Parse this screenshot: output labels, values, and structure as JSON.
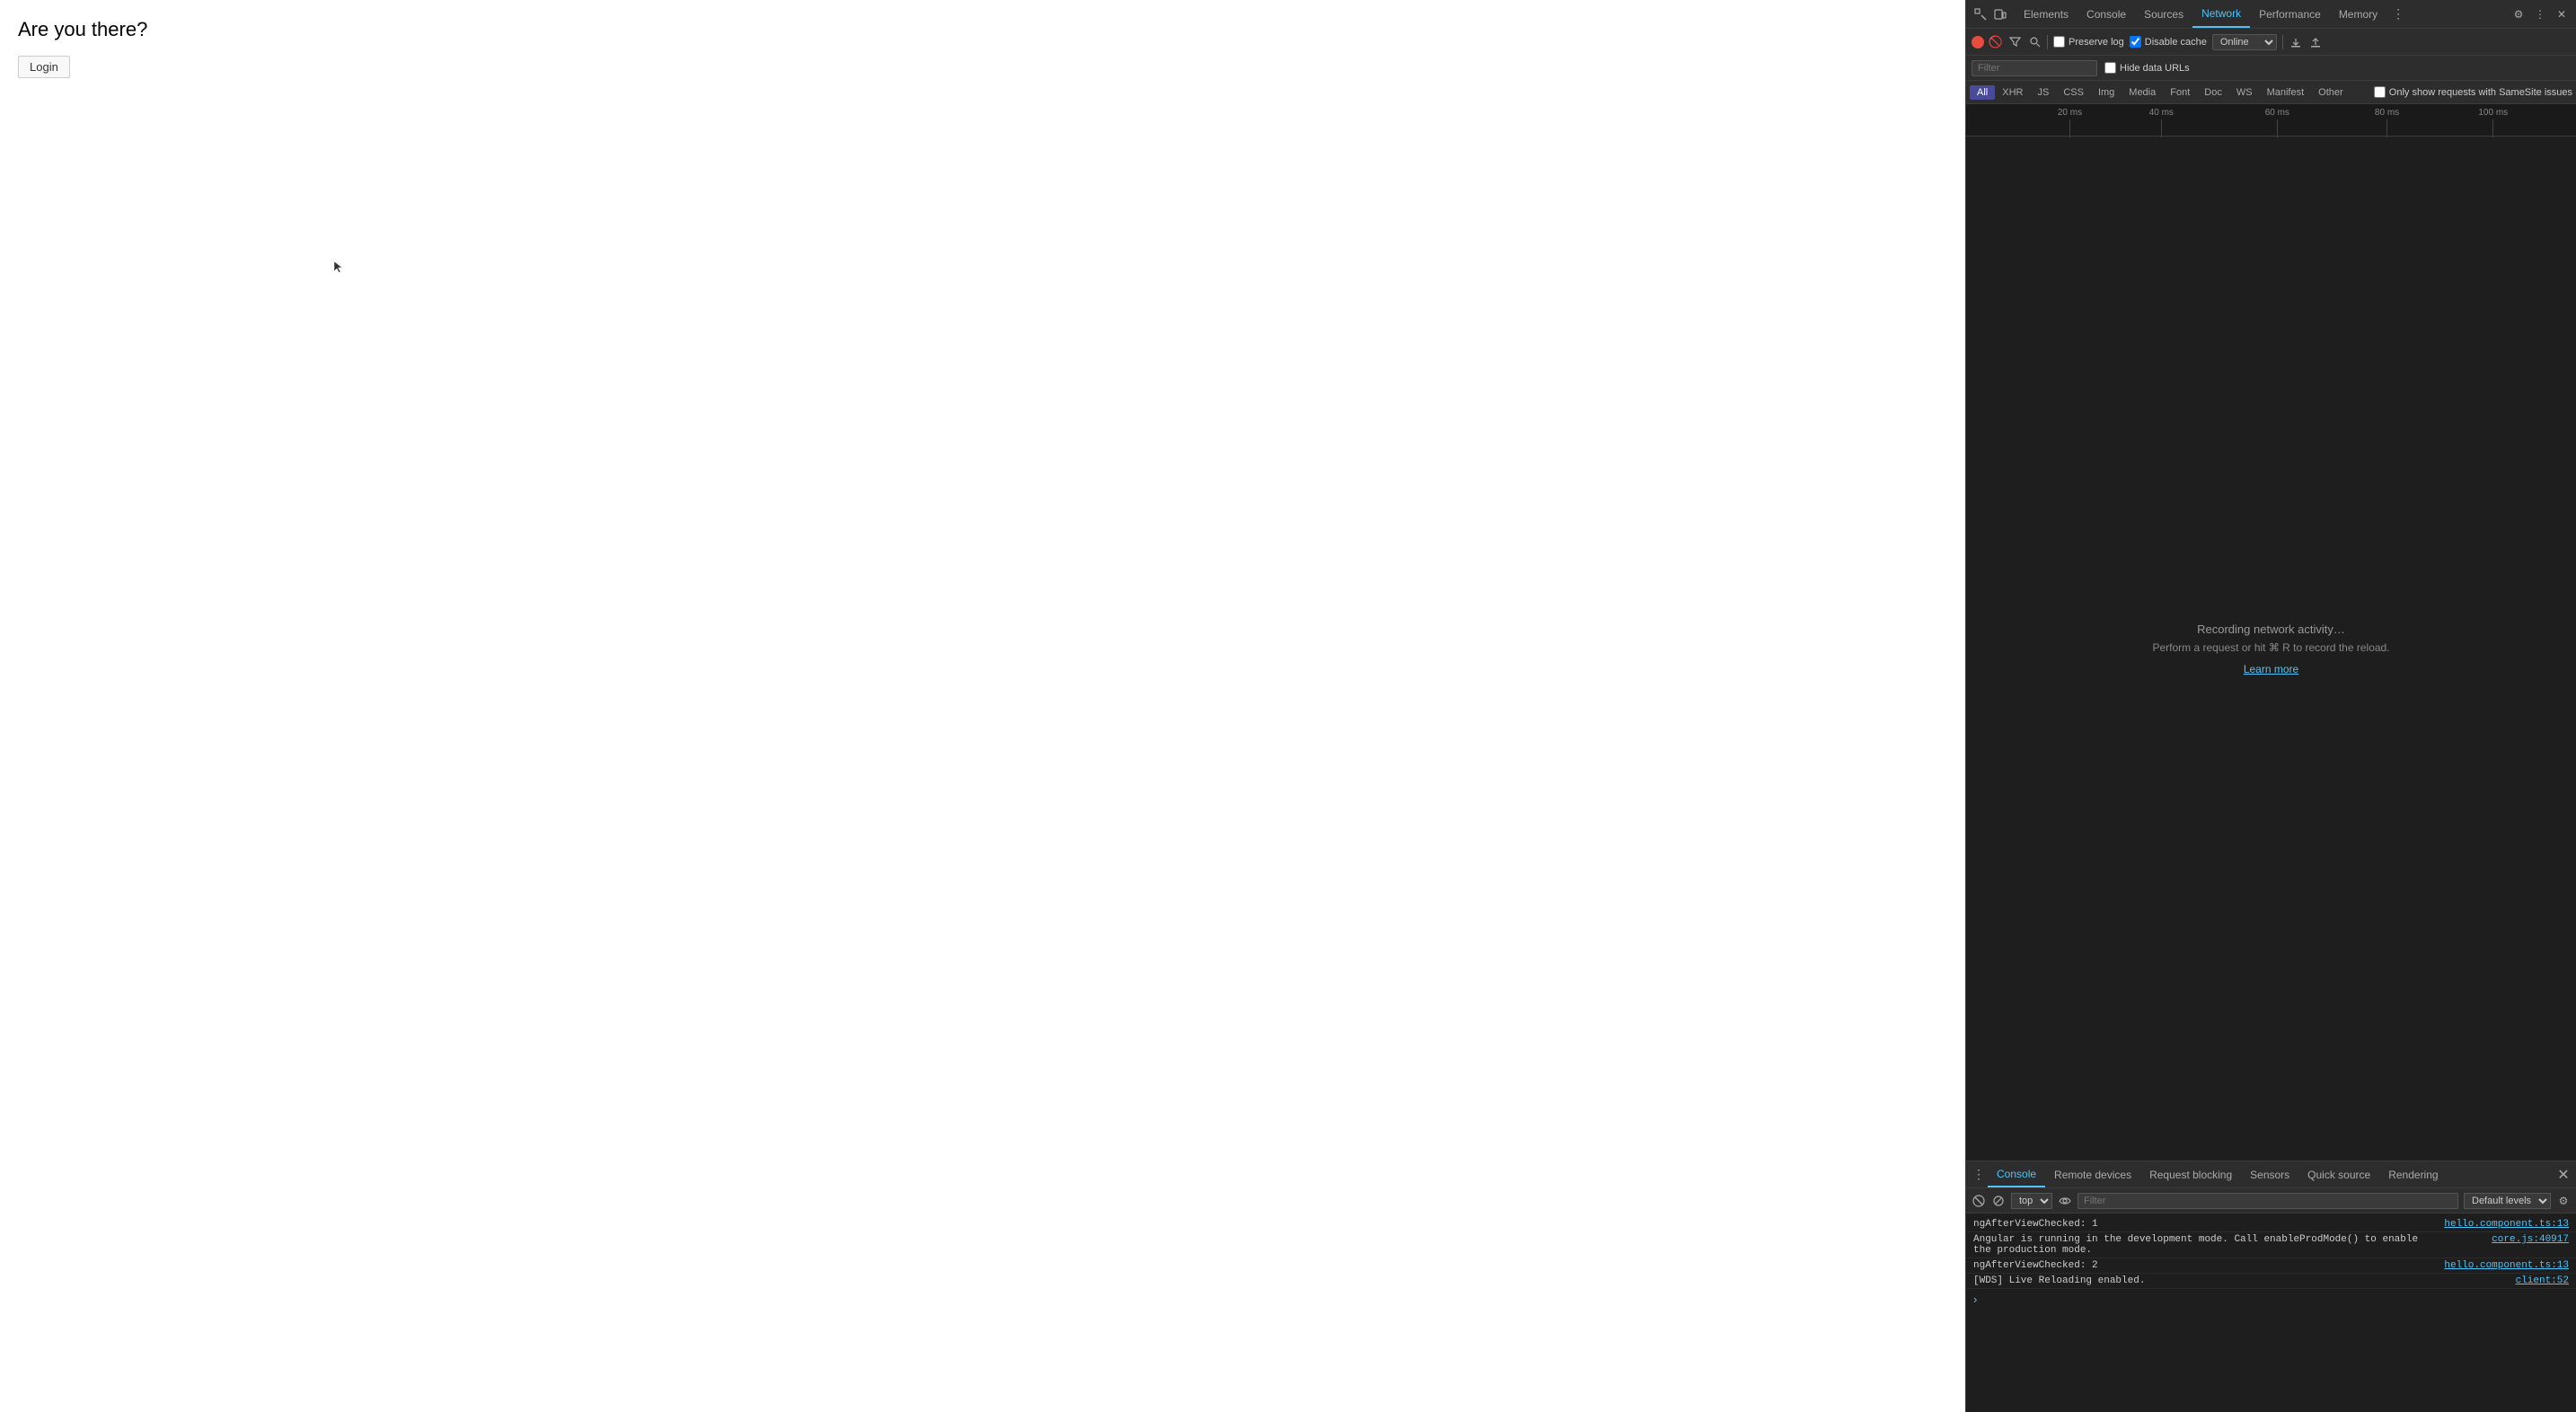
{
  "page": {
    "heading": "Are you there?",
    "login_button": "Login"
  },
  "devtools": {
    "tabs": [
      {
        "label": "Elements",
        "active": false
      },
      {
        "label": "Console",
        "active": false
      },
      {
        "label": "Sources",
        "active": false
      },
      {
        "label": "Network",
        "active": true
      },
      {
        "label": "Performance",
        "active": false
      },
      {
        "label": "Memory",
        "active": false
      }
    ],
    "more_tabs_icon": "⋮",
    "close_icon": "✕",
    "settings_icon": "⚙",
    "dock_icon": "⊟",
    "undock_icon": "⧉"
  },
  "network": {
    "record_btn_title": "Record",
    "stop_btn_title": "Stop",
    "filter_icon_title": "Filter",
    "search_icon_title": "Search",
    "preserve_log_label": "Preserve log",
    "preserve_log_checked": false,
    "disable_cache_label": "Disable cache",
    "disable_cache_checked": true,
    "throttle_value": "Online",
    "filter_placeholder": "Filter",
    "hide_data_urls_label": "Hide data URLs",
    "hide_data_urls_checked": false,
    "type_filters": [
      {
        "label": "All",
        "active": true
      },
      {
        "label": "XHR",
        "active": false
      },
      {
        "label": "JS",
        "active": false
      },
      {
        "label": "CSS",
        "active": false
      },
      {
        "label": "Img",
        "active": false
      },
      {
        "label": "Media",
        "active": false
      },
      {
        "label": "Font",
        "active": false
      },
      {
        "label": "Doc",
        "active": false
      },
      {
        "label": "WS",
        "active": false
      },
      {
        "label": "Manifest",
        "active": false
      },
      {
        "label": "Other",
        "active": false
      }
    ],
    "samesite_label": "Only show requests with SameSite issues",
    "samesite_checked": false,
    "timeline_marks": [
      {
        "label": "20 ms",
        "left_pct": 15
      },
      {
        "label": "40 ms",
        "left_pct": 30
      },
      {
        "label": "60 ms",
        "left_pct": 50
      },
      {
        "label": "80 ms",
        "left_pct": 70
      },
      {
        "label": "100 ms",
        "left_pct": 88
      }
    ],
    "recording_text": "Recording network activity…",
    "perform_text": "Perform a request or hit ⌘ R to record the reload.",
    "learn_more_label": "Learn more",
    "import_label": "Import HAR",
    "export_label": "Export HAR"
  },
  "drawer": {
    "tabs": [
      {
        "label": "Console",
        "active": true
      },
      {
        "label": "Remote devices",
        "active": false
      },
      {
        "label": "Request blocking",
        "active": false
      },
      {
        "label": "Sensors",
        "active": false
      },
      {
        "label": "Quick source",
        "active": false
      },
      {
        "label": "Rendering",
        "active": false
      }
    ],
    "close_icon": "✕",
    "more_icon": "⋮"
  },
  "console": {
    "clear_icon_title": "Clear console",
    "hide_network_title": "Hide network",
    "context_value": "top",
    "filter_placeholder": "Filter",
    "levels_label": "Default levels",
    "logs": [
      {
        "msg": "ngAfterViewChecked: 1",
        "source": "hello.component.ts:13"
      },
      {
        "msg": "Angular is running in the development mode. Call enableProdMode() to enable\nthe production mode.",
        "source": "core.js:40917"
      },
      {
        "msg": "ngAfterViewChecked: 2",
        "source": "hello.component.ts:13"
      },
      {
        "msg": "[WDS] Live Reloading enabled.",
        "source": "client:52"
      }
    ]
  }
}
